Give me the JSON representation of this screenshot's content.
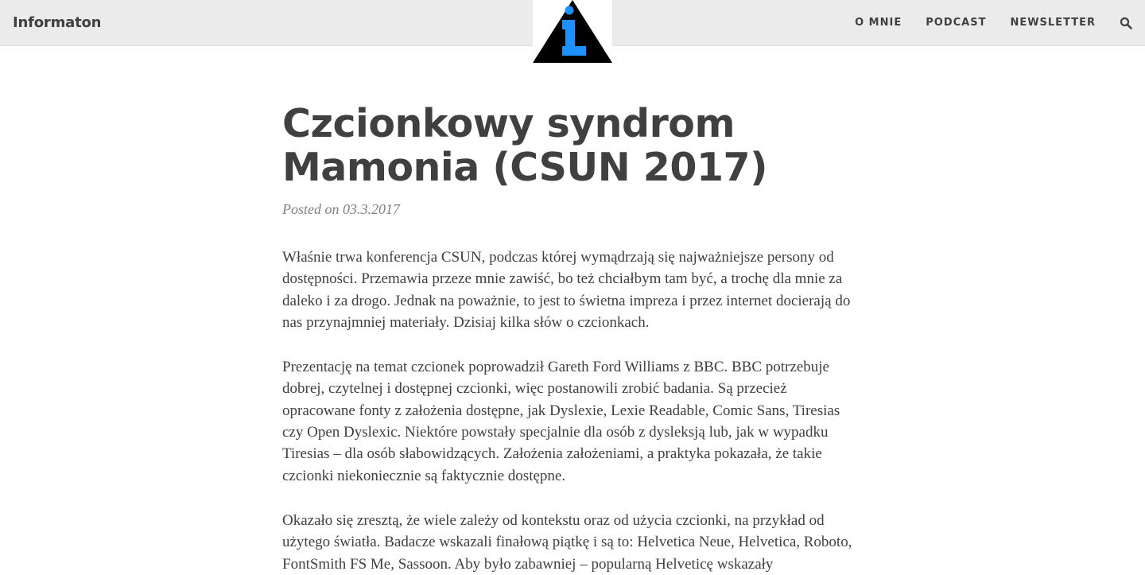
{
  "header": {
    "brand": "Informaton",
    "nav": [
      "O MNIE",
      "PODCAST",
      "NEWSLETTER"
    ],
    "search_icon": "search-icon",
    "logo_icon": "information-triangle-icon",
    "logo_colors": {
      "triangle": "#000000",
      "glyph": "#1e90ff"
    }
  },
  "post": {
    "title": "Czcionkowy syndrom Mamonia (CSUN 2017)",
    "meta": "Posted on 03.3.2017",
    "paragraphs": [
      "Właśnie trwa konferencja CSUN, podczas której wymądrzają się najważniejsze persony od dostępności. Przemawia przeze mnie zawiść, bo też chciałbym tam być, a trochę dla mnie za daleko i za drogo. Jednak na poważnie, to jest to świetna impreza i przez internet docierają do nas przynajmniej materiały. Dzisiaj kilka słów o czcionkach.",
      "Prezentację na temat czcionek poprowadził Gareth Ford Williams z BBC. BBC potrzebuje dobrej, czytelnej i dostępnej czcionki, więc postanowili zrobić badania. Są przecież opracowane fonty z założenia dostępne, jak Dyslexie, Lexie Readable, Comic Sans, Tiresias czy Open Dyslexic. Niektóre powstały specjalnie dla osób z dysleksją lub, jak w wypadku Tiresias – dla osób słabowidzących. Założenia założeniami, a praktyka pokazała, że takie czcionki niekoniecznie są faktycznie dostępne.",
      "Okazało się zresztą, że wiele zależy od kontekstu oraz od użycia czcionki, na przykład od użytego światła. Badacze wskazali finałową piątkę i są to: Helvetica Neue, Helvetica, Roboto, FontSmith FS Me, Sassoon. Aby było zabawniej – popularną Helveticę wskazały"
    ]
  }
}
